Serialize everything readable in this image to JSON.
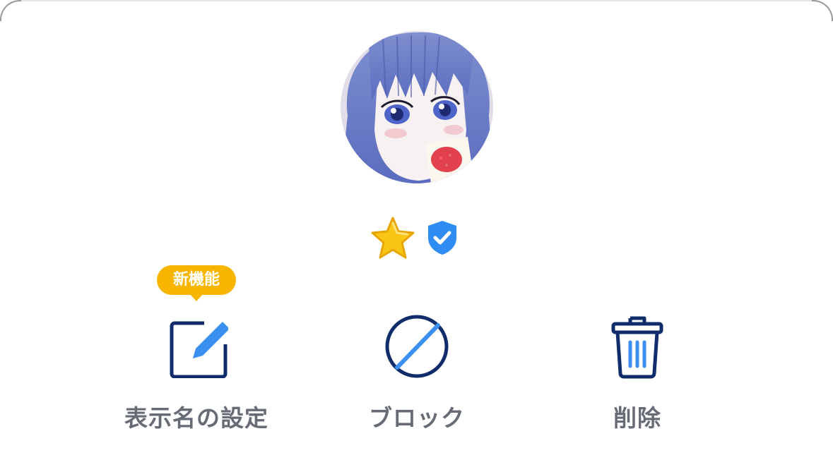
{
  "profile": {
    "avatar_icon": "avatar-illustration",
    "badges": [
      {
        "icon": "star-icon",
        "color": "#f5b800"
      },
      {
        "icon": "verified-shield-icon",
        "color": "#2f8cf2"
      }
    ]
  },
  "new_feature_badge": {
    "label": "新機能",
    "color": "#f7b500"
  },
  "actions": [
    {
      "id": "edit",
      "label": "表示名の設定",
      "icon": "edit-icon"
    },
    {
      "id": "block",
      "label": "ブロック",
      "icon": "block-icon"
    },
    {
      "id": "delete",
      "label": "削除",
      "icon": "trash-icon"
    }
  ],
  "colors": {
    "icon_dark": "#102c6b",
    "icon_accent": "#3b8ff0",
    "label_gray": "#666b75"
  }
}
